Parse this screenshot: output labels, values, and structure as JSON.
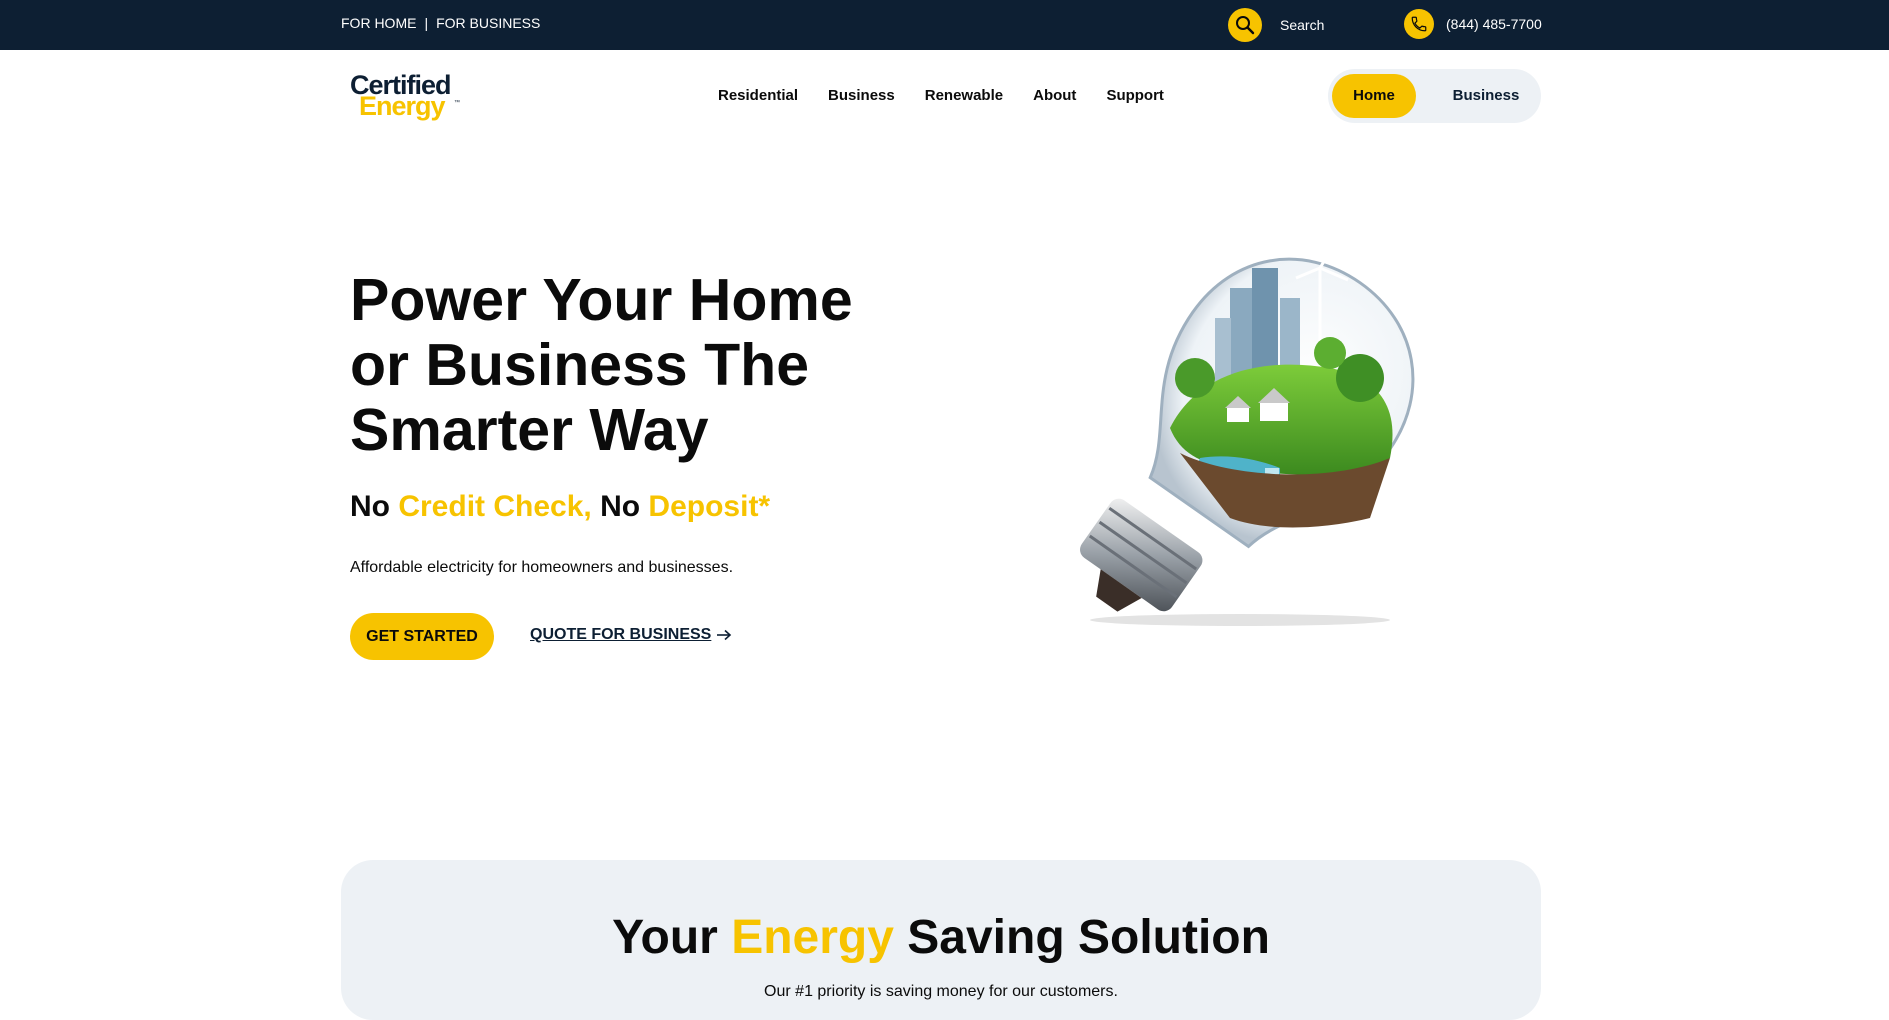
{
  "topbar": {
    "for_home": "FOR HOME",
    "separator": "|",
    "for_business": "FOR BUSINESS",
    "search_label": "Search",
    "search_icon": "magnifier-icon",
    "phone_icon": "phone-icon",
    "phone": "(844) 485-7700"
  },
  "header": {
    "logo_line1": "Certified",
    "logo_line2": "Energy",
    "logo_tm": "™",
    "nav": [
      "Residential",
      "Business",
      "Renewable",
      "About",
      "Support"
    ],
    "toggle": {
      "home": "Home",
      "business": "Business"
    }
  },
  "hero": {
    "title": "Power Your Home or Business The Smarter Way",
    "sub": {
      "p1": "No",
      "p2": "Credit Check,",
      "p3": "No",
      "p4": "Deposit*"
    },
    "description": "Affordable electricity for homeowners and businesses.",
    "cta_primary": "GET STARTED",
    "cta_secondary": "QUOTE FOR BUSINESS",
    "arrow_icon": "arrow-right-icon",
    "image_icon": "light-bulb-landscape-illustration"
  },
  "savings": {
    "title": {
      "p1": "Your",
      "p2": "Energy",
      "p3": "Saving Solution"
    },
    "subtitle": "Our #1 priority is saving money for our customers."
  },
  "colors": {
    "navy": "#0d1f33",
    "yellow": "#f7c300",
    "light_panel": "#edf1f5"
  }
}
